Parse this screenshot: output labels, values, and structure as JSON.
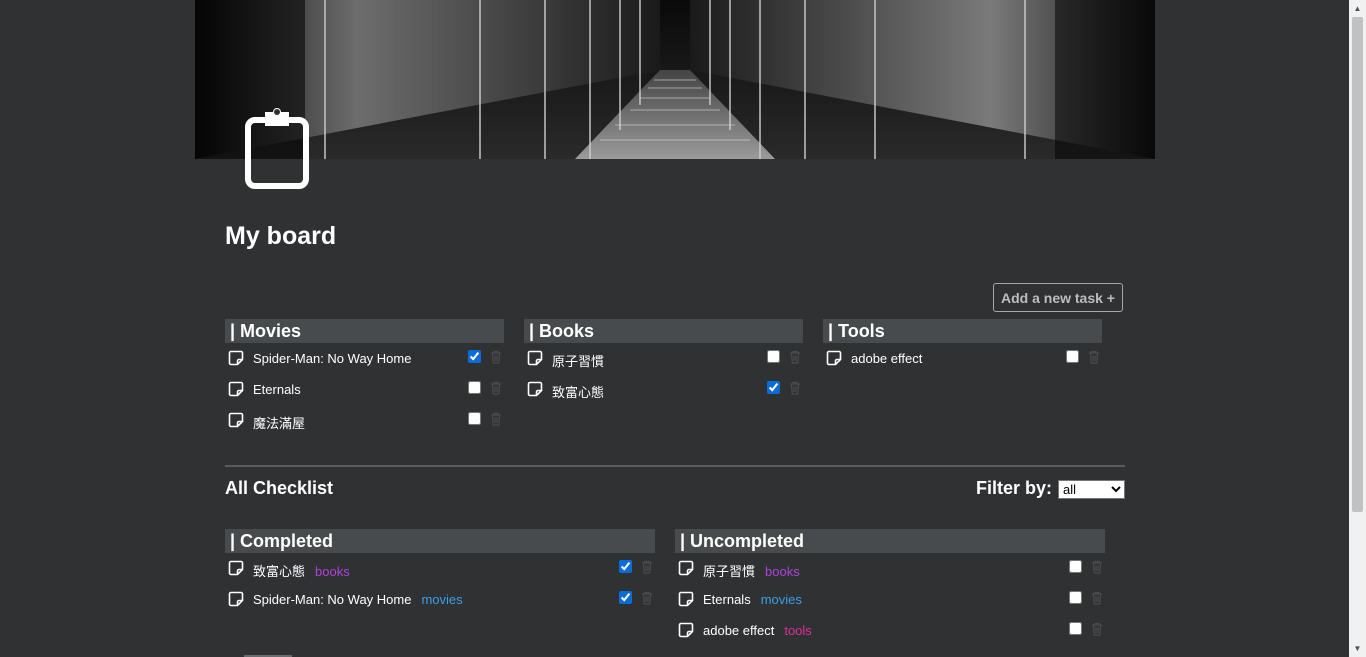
{
  "board": {
    "title": "My board",
    "add_task_label": "Add a new task +"
  },
  "columns": [
    {
      "name": "| Movies",
      "tasks": [
        {
          "name": "Spider-Man: No Way Home",
          "done": true
        },
        {
          "name": "Eternals",
          "done": false
        },
        {
          "name": "魔法滿屋",
          "done": false
        }
      ]
    },
    {
      "name": "| Books",
      "tasks": [
        {
          "name": "原子習慣",
          "done": false
        },
        {
          "name": "致富心態",
          "done": true
        }
      ]
    },
    {
      "name": "| Tools",
      "tasks": [
        {
          "name": "adobe effect",
          "done": false
        }
      ]
    }
  ],
  "checklist": {
    "title": "All Checklist",
    "filter_label": "Filter by:",
    "filter_selected": "all",
    "completed": {
      "name": "| Completed",
      "tasks": [
        {
          "name": "致富心態",
          "tag": "books",
          "done": true
        },
        {
          "name": "Spider-Man: No Way Home",
          "tag": "movies",
          "done": true
        }
      ]
    },
    "uncompleted": {
      "name": "| Uncompleted",
      "tasks": [
        {
          "name": "原子習慣",
          "tag": "books",
          "done": false
        },
        {
          "name": "Eternals",
          "tag": "movies",
          "done": false
        },
        {
          "name": "adobe effect",
          "tag": "tools",
          "done": false
        }
      ]
    }
  },
  "colors": {
    "background": "#2f3133",
    "header_bar": "#474b4d",
    "tag_books": "#b042e0",
    "tag_movies": "#3aa0e6",
    "tag_tools": "#e02f9c"
  },
  "icons": {
    "board": "clipboard-icon",
    "task": "note-icon",
    "delete": "trash-icon"
  }
}
